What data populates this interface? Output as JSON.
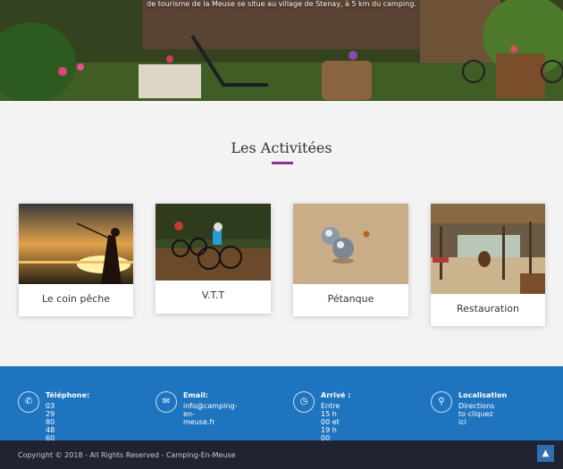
{
  "hero": {
    "caption": "de tourisme de la Meuse se situe au village de Stenay, à 5 km du camping."
  },
  "activities": {
    "title": "Les Activitées",
    "cards": [
      {
        "label": "Le coin pêche"
      },
      {
        "label": "V.T.T"
      },
      {
        "label": "Pétanque"
      },
      {
        "label": "Restauration"
      }
    ]
  },
  "contact": {
    "items": [
      {
        "icon": "phone-icon",
        "title": "Téléphone:",
        "line1": "03 29 80 48 60",
        "line2": ""
      },
      {
        "icon": "email-icon",
        "title": "Email:",
        "line1": "info@camping-en-",
        "line2": "meuse.fr"
      },
      {
        "icon": "clock-icon",
        "title": "Arrivé :",
        "line1": "Entre 15 h 00 et 19 h 00",
        "line2": ""
      },
      {
        "icon": "location-icon",
        "title": "Localisation",
        "line1": "Directions to cliquez ici",
        "line2": ""
      }
    ]
  },
  "footer": {
    "copyright": "Copyright © 2018 - All Rights Reserved - Camping-En-Meuse",
    "to_top_icon": "chevron-up-icon"
  },
  "colors": {
    "accent": "#8b2f8f",
    "info_bar": "#1f74bf",
    "footer_bar": "#202432"
  }
}
